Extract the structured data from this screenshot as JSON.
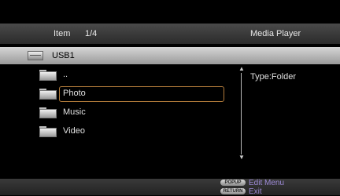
{
  "header": {
    "item_label": "Item",
    "item_count": "1/4",
    "title": "Media Player"
  },
  "path": {
    "drive_icon": "usb-drive-icon",
    "text": "USB1"
  },
  "list": {
    "items": [
      {
        "label": "..",
        "icon": "parent-folder-icon"
      },
      {
        "label": "Photo",
        "icon": "folder-icon",
        "selected": true
      },
      {
        "label": "Music",
        "icon": "folder-icon"
      },
      {
        "label": "Video",
        "icon": "folder-icon"
      }
    ]
  },
  "info": {
    "type_text": "Type:Folder"
  },
  "scrollbar": {
    "up_glyph": "▲",
    "down_glyph": "▼"
  },
  "footer": {
    "popup_key": "POPUP",
    "popup_label": "Edit Menu",
    "return_key": "RETURN",
    "return_label": "Exit"
  },
  "colors": {
    "selection_border": "#b07a3a",
    "hint_text": "#9d8ad6"
  }
}
